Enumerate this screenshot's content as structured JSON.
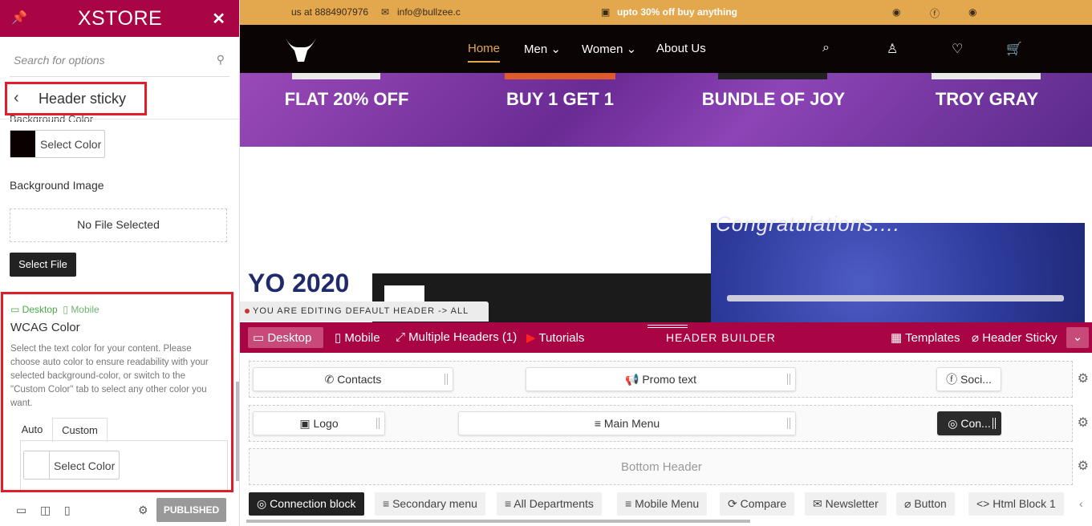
{
  "sidebar": {
    "brand": "XSTORE",
    "search_placeholder": "Search for options",
    "section_title": "Header sticky",
    "bg_color_label": "Background Color",
    "select_color": "Select Color",
    "bg_image_label": "Background Image",
    "no_file": "No File Selected",
    "select_file": "Select File",
    "wcag": {
      "desktop": "Desktop",
      "mobile": "Mobile",
      "title": "WCAG Color",
      "desc": "Select the text color for your content. Please choose auto color to ensure readability with your selected background-color, or switch to the \"Custom Color\" tab to select any other color you want.",
      "tab_auto": "Auto",
      "tab_custom": "Custom",
      "select_color": "Select Color"
    },
    "published": "PUBLISHED",
    "colors": {
      "accent": "#a90444",
      "swatch": "#0a0000"
    }
  },
  "preview": {
    "topbar": {
      "phone": "us at 8884907976",
      "email": "info@bullzee.c",
      "promo": "upto 30% off buy anything"
    },
    "nav": {
      "items": [
        "Home",
        "Men",
        "Women",
        "About Us"
      ]
    },
    "banner": [
      "FLAT 20% OFF",
      "BUY 1 GET 1",
      "BUNDLE OF JOY",
      "TROY GRAY"
    ],
    "tokyo": "YO 2020",
    "congrats": "Congratulations....",
    "editing": "YOU ARE EDITING DEFAULT HEADER -> ALL SITE"
  },
  "builder_bar": {
    "desktop": "Desktop",
    "mobile": "Mobile",
    "multiple": "Multiple Headers (1)",
    "tutorials": "Tutorials",
    "title": "HEADER BUILDER",
    "templates": "Templates",
    "sticky": "Header Sticky"
  },
  "rows": {
    "top": {
      "contacts": "Contacts",
      "promo": "Promo text",
      "social": "Soci..."
    },
    "main": {
      "logo": "Logo",
      "menu": "Main Menu",
      "conn": "Con..."
    },
    "bottom": "Bottom Header"
  },
  "bottom_items": [
    "Connection block",
    "Secondary menu",
    "All Departments",
    "Mobile Menu",
    "Compare",
    "Newsletter",
    "Button",
    "Html Block 1"
  ]
}
